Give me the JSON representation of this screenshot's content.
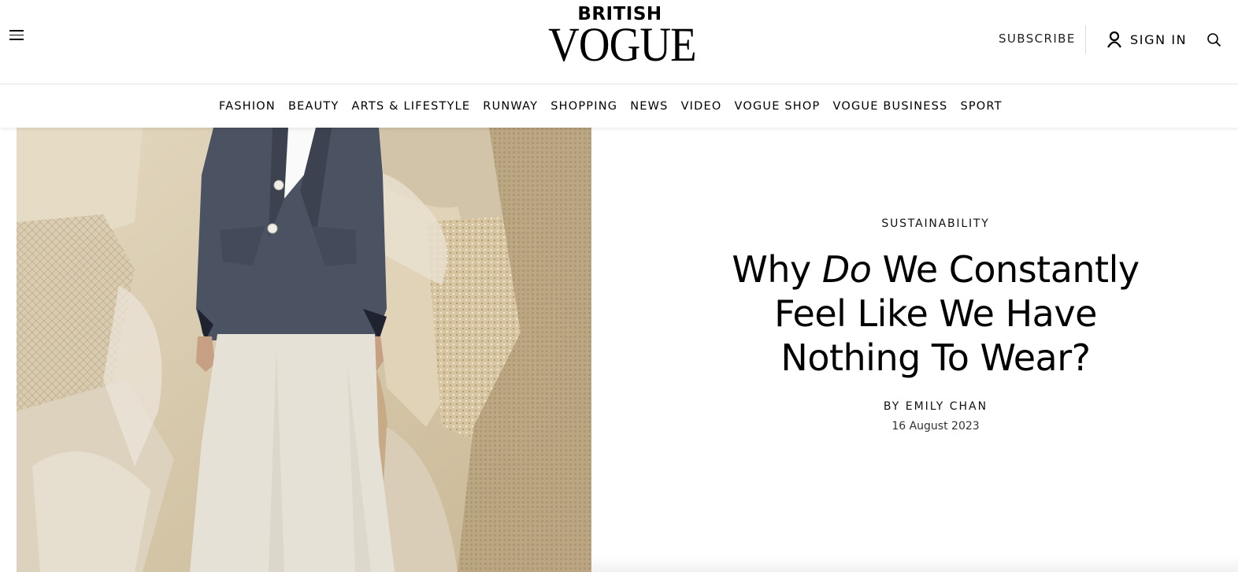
{
  "header": {
    "logo_top": "BRITISH",
    "logo_main": "VOGUE",
    "subscribe_label": "SUBSCRIBE",
    "signin_label": "SIGN IN",
    "icons": {
      "menu": "hamburger-menu-icon",
      "account": "user-icon",
      "search": "search-icon"
    }
  },
  "nav": {
    "items": [
      "FASHION",
      "BEAUTY",
      "ARTS & LIFESTYLE",
      "RUNWAY",
      "SHOPPING",
      "NEWS",
      "VIDEO",
      "VOGUE SHOP",
      "VOGUE BUSINESS",
      "SPORT"
    ]
  },
  "article": {
    "category": "SUSTAINABILITY",
    "headline": {
      "part1": "Why ",
      "emphasis": "Do",
      "part2": " We Constantly Feel Like We Have Nothing To Wear?"
    },
    "byline_prefix": "BY ",
    "author": "EMILY CHAN",
    "date": "16 August 2023"
  },
  "colors": {
    "text": "#000000",
    "hero_background": "#d4c6aa",
    "jacket": "#4b5262",
    "skirt": "#e6e1d6",
    "divider": "#e6e6e6"
  }
}
